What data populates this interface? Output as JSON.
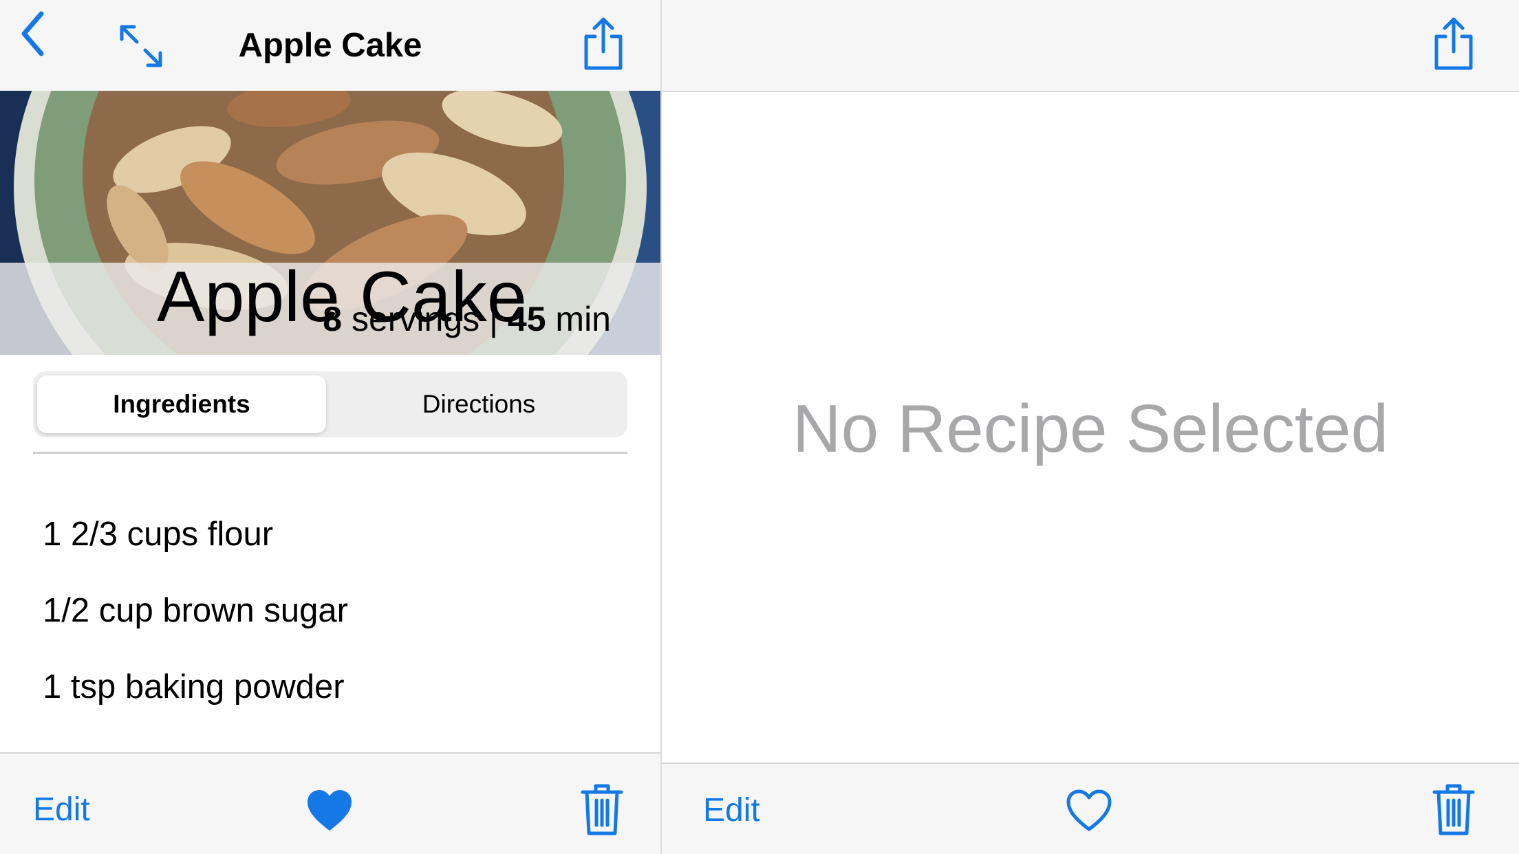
{
  "left": {
    "nav": {
      "title": "Apple Cake",
      "back_icon": "chevron-left-icon",
      "expand_icon": "expand-arrows-icon",
      "share_icon": "share-icon"
    },
    "hero": {
      "title": "Apple Cake",
      "servings_count": "8",
      "servings_label": " servings | ",
      "time_value": "45",
      "time_label": " min"
    },
    "tabs": [
      {
        "label": "Ingredients",
        "selected": true
      },
      {
        "label": "Directions",
        "selected": false
      }
    ],
    "ingredients": [
      "1 2/3 cups flour",
      "1/2 cup brown sugar",
      "1 tsp baking powder"
    ],
    "toolbar": {
      "edit_label": "Edit",
      "favorite_icon": "heart-filled-icon",
      "delete_icon": "trash-icon"
    }
  },
  "right": {
    "nav": {
      "share_icon": "share-icon"
    },
    "placeholder": "No Recipe Selected",
    "toolbar": {
      "edit_label": "Edit",
      "favorite_icon": "heart-outline-icon",
      "delete_icon": "trash-icon"
    }
  },
  "colors": {
    "accent": "#1479e6",
    "bar_background": "#f6f6f6",
    "placeholder_text": "#a8a8aa"
  }
}
